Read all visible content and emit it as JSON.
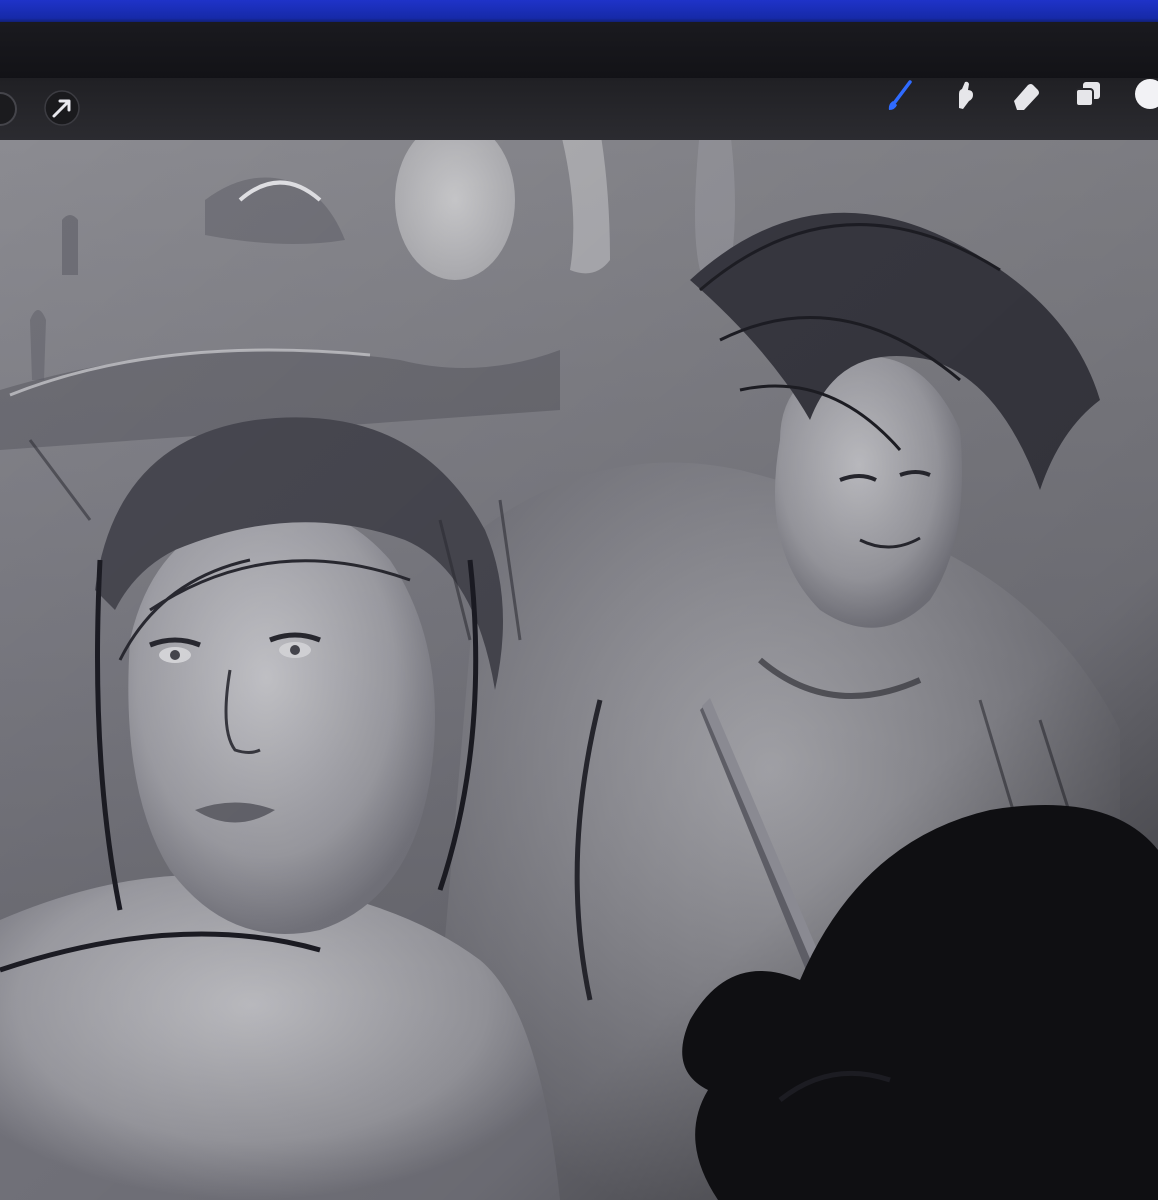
{
  "app": {
    "name": "drawing-app-canvas"
  },
  "toolbar": {
    "left_tools": [
      {
        "icon": "gallery-partial-icon"
      },
      {
        "icon": "transform-arrow-icon"
      }
    ],
    "right_tools": [
      {
        "icon": "brush-icon",
        "active": true
      },
      {
        "icon": "smudge-icon",
        "active": false
      },
      {
        "icon": "eraser-icon",
        "active": false
      },
      {
        "icon": "layers-icon",
        "active": false
      },
      {
        "icon": "color-swatch-icon",
        "active": false
      }
    ]
  },
  "colors": {
    "active_tool": "#2f6bff",
    "toolbar_bg": "#26262a",
    "canvas_tone": "#8e8e96",
    "monitor_glow": "#1f33c9"
  }
}
